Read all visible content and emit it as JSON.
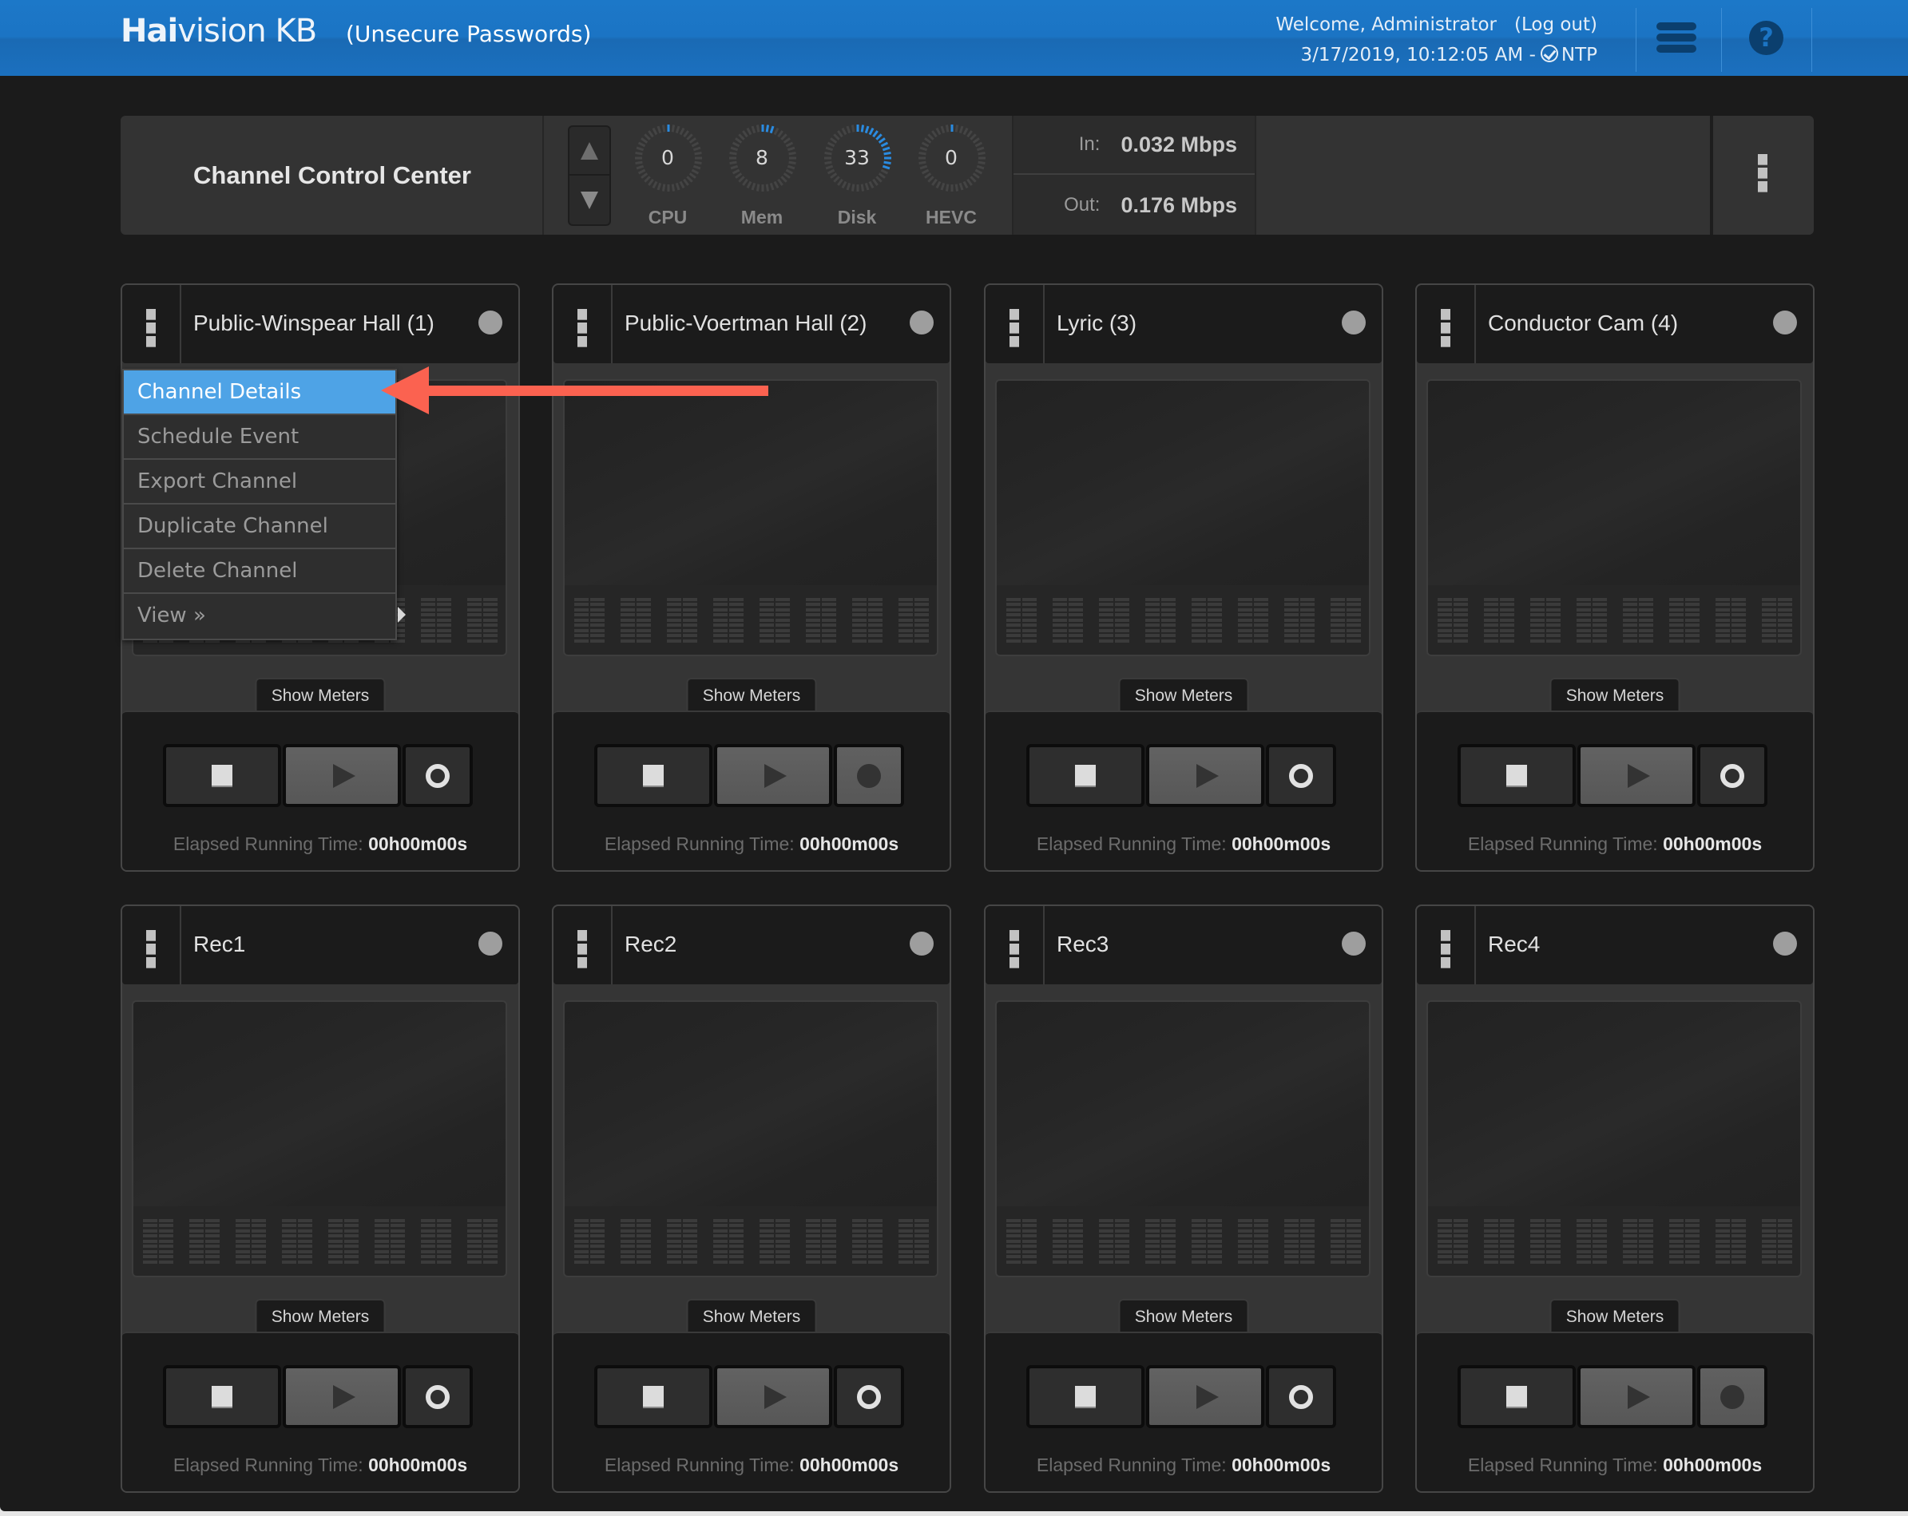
{
  "header": {
    "brand_bold": "Hai",
    "brand_rest": "vision KB",
    "subtitle": "(Unsecure Passwords)",
    "welcome": "Welcome, Administrator",
    "logout": "(Log out)",
    "datetime": "3/17/2019, 10:12:05 AM -",
    "ntp": "NTP",
    "icons": [
      "hamburger-menu-icon",
      "help-icon"
    ]
  },
  "control_center": {
    "title": "Channel Control Center",
    "gauges": [
      {
        "label": "CPU",
        "value": "0",
        "percent": 0
      },
      {
        "label": "Mem",
        "value": "8",
        "percent": 8
      },
      {
        "label": "Disk",
        "value": "33",
        "percent": 33
      },
      {
        "label": "HEVC",
        "value": "0",
        "percent": 0
      }
    ],
    "bandwidth": {
      "in_label": "In:",
      "in_value": "0.032 Mbps",
      "out_label": "Out:",
      "out_value": "0.176 Mbps"
    },
    "accent_color": "#2a8be0"
  },
  "channels": [
    {
      "title": "Public-Winspear Hall (1)",
      "show_meters": "Show Meters",
      "elapsed_label": "Elapsed Running Time:",
      "elapsed_value": "00h00m00s",
      "record_state": "ring"
    },
    {
      "title": "Public-Voertman Hall (2)",
      "show_meters": "Show Meters",
      "elapsed_label": "Elapsed Running Time:",
      "elapsed_value": "00h00m00s",
      "record_state": "dot"
    },
    {
      "title": "Lyric (3)",
      "show_meters": "Show Meters",
      "elapsed_label": "Elapsed Running Time:",
      "elapsed_value": "00h00m00s",
      "record_state": "ring"
    },
    {
      "title": "Conductor Cam (4)",
      "show_meters": "Show Meters",
      "elapsed_label": "Elapsed Running Time:",
      "elapsed_value": "00h00m00s",
      "record_state": "ring"
    },
    {
      "title": "Rec1",
      "show_meters": "Show Meters",
      "elapsed_label": "Elapsed Running Time:",
      "elapsed_value": "00h00m00s",
      "record_state": "ring"
    },
    {
      "title": "Rec2",
      "show_meters": "Show Meters",
      "elapsed_label": "Elapsed Running Time:",
      "elapsed_value": "00h00m00s",
      "record_state": "ring"
    },
    {
      "title": "Rec3",
      "show_meters": "Show Meters",
      "elapsed_label": "Elapsed Running Time:",
      "elapsed_value": "00h00m00s",
      "record_state": "ring"
    },
    {
      "title": "Rec4",
      "show_meters": "Show Meters",
      "elapsed_label": "Elapsed Running Time:",
      "elapsed_value": "00h00m00s",
      "record_state": "dot"
    }
  ],
  "context_menu": {
    "items": [
      {
        "label": "Channel Details",
        "active": true
      },
      {
        "label": "Schedule Event",
        "active": false
      },
      {
        "label": "Export Channel",
        "active": false
      },
      {
        "label": "Duplicate Channel",
        "active": false
      },
      {
        "label": "Delete Channel",
        "active": false
      },
      {
        "label": "View »",
        "active": false,
        "submenu": true
      }
    ]
  },
  "annotation": {
    "type": "arrow",
    "color": "#fb6250",
    "points_to": "Channel Details"
  }
}
